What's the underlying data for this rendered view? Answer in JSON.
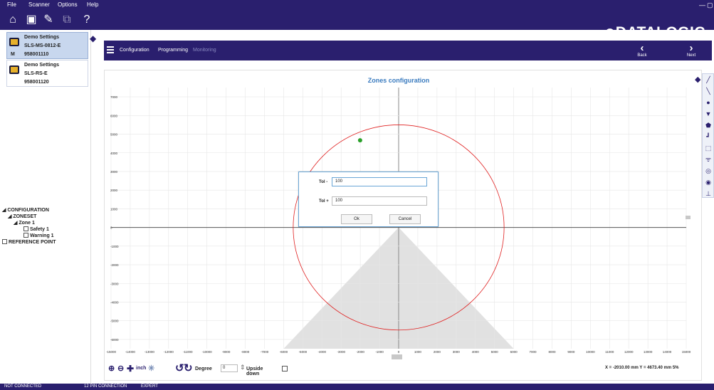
{
  "menu": {
    "file": "File",
    "scanner": "Scanner",
    "options": "Options",
    "help": "Help"
  },
  "window_controls": {
    "minimize": "—",
    "restore": "▢"
  },
  "logo": "DATALOGIC",
  "devices": [
    {
      "name": "Demo Settings",
      "model": "SLS-MS-0812-E",
      "mode": "M",
      "serial": "958001110"
    },
    {
      "name": "Demo Settings",
      "model": "SLS-RS-E",
      "mode": "",
      "serial": "958001120"
    }
  ],
  "nav": {
    "configuration": "Configuration",
    "programming": "Programming",
    "monitoring": "Monitoring",
    "back": "Back",
    "next": "Next"
  },
  "title": "Zones configuration",
  "tree": {
    "configuration": "CONFIGURATION",
    "zoneset": "ZONESET",
    "zone1": "Zone 1",
    "safety1": "Safety 1",
    "warning1": "Warning 1",
    "reference_point": "REFERENCE POINT"
  },
  "dialog": {
    "tol_minus_label": "Tol -",
    "tol_minus_value": "100",
    "tol_plus_label": "Tol +",
    "tol_plus_value": "100",
    "ok": "Ok",
    "cancel": "Cancel"
  },
  "bottom": {
    "unit": "inch",
    "degree_label": "Degree",
    "degree_value": "0",
    "upside_down": "Upside down"
  },
  "coords": "X = -2010.00 mm  Y = 4673.40 mm  5%",
  "status": {
    "connection": "NOT CONNECTED",
    "pins": "12 PIN CONNECTION",
    "level": "EXPERT"
  },
  "chart_data": {
    "type": "scatter",
    "x_ticks": [
      "-15000",
      "-14000",
      "-13000",
      "-12000",
      "-11000",
      "-10000",
      "-9000",
      "-8000",
      "-7000",
      "-6000",
      "-5000",
      "-4000",
      "-3000",
      "-2000",
      "-1000",
      "0",
      "1000",
      "2000",
      "3000",
      "4000",
      "5000",
      "6000",
      "7000",
      "8000",
      "9000",
      "10000",
      "11000",
      "12000",
      "13000",
      "14000",
      "15000"
    ],
    "y_ticks": [
      "7000",
      "6000",
      "5000",
      "4000",
      "3000",
      "2000",
      "1000",
      "0",
      "-1000",
      "-2000",
      "-3000",
      "-4000",
      "-5000",
      "-6000"
    ],
    "xlim": [
      -15000,
      15000
    ],
    "ylim": [
      -6500,
      7500
    ],
    "grid": true,
    "circle": {
      "cx": 0,
      "cy": 0,
      "r": 5500,
      "color": "#e02020"
    },
    "points": [
      {
        "x": -2010,
        "y": 4673.4,
        "color": "#2aa02a"
      }
    ],
    "triangle_cone": {
      "apex": [
        0,
        0
      ],
      "left": [
        -6000,
        -8500
      ],
      "right": [
        6000,
        -8500
      ],
      "color": "#d9d9d9"
    }
  }
}
